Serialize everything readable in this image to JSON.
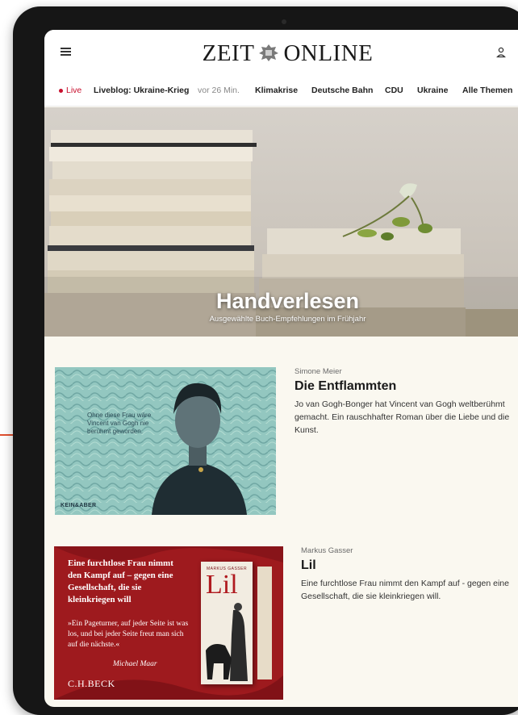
{
  "header": {
    "logo_left": "ZEIT",
    "logo_right": "ONLINE"
  },
  "nav": {
    "live": "Live",
    "liveblog": "Liveblog: Ukraine-Krieg",
    "liveblog_time": "vor 26 Min.",
    "items": [
      "Klimakrise",
      "Deutsche Bahn",
      "CDU",
      "Ukraine",
      "Alle Themen"
    ]
  },
  "hero": {
    "title": "Handverlesen",
    "subtitle": "Ausgewählte Buch-Empfehlungen im Frühjahr"
  },
  "articles": [
    {
      "author": "Simone Meier",
      "title": "Die Entflammten",
      "teaser": "Jo van Gogh-Bonger hat Vincent van Gogh weltberühmt gemacht. Ein rauschhafter Roman über die Liebe und die Kunst.",
      "image_text": "Ohne diese Frau wäre Vincent van Gogh nie berühmt geworden.",
      "image_publisher": "KEIN&ABER"
    },
    {
      "author": "Markus Gasser",
      "title": "Lil",
      "teaser": "Eine furchtlose Frau nimmt den Kampf auf - gegen eine Gesellschaft, die sie kleinkriegen will.",
      "image_headline": "Eine furchtlose Frau nimmt den Kampf auf – gegen eine Gesellschaft, die sie kleinkriegen will",
      "image_quote": "»Ein Pageturner, auf jeder Seite ist was los, und bei jeder Seite freut man sich auf die nächste.«",
      "image_quote_author": "Michael Maar",
      "image_publisher": "C.H.BECK",
      "book_author": "MARKUS GASSER",
      "book_title": "Lil"
    }
  ],
  "colors": {
    "live_red": "#c8102e",
    "ad_red": "#a01a1f",
    "page_bg": "#faf8f0",
    "accent": "#e0502f"
  },
  "icons": {
    "menu": "hamburger-icon",
    "user": "user-icon",
    "crest": "crest-icon"
  }
}
